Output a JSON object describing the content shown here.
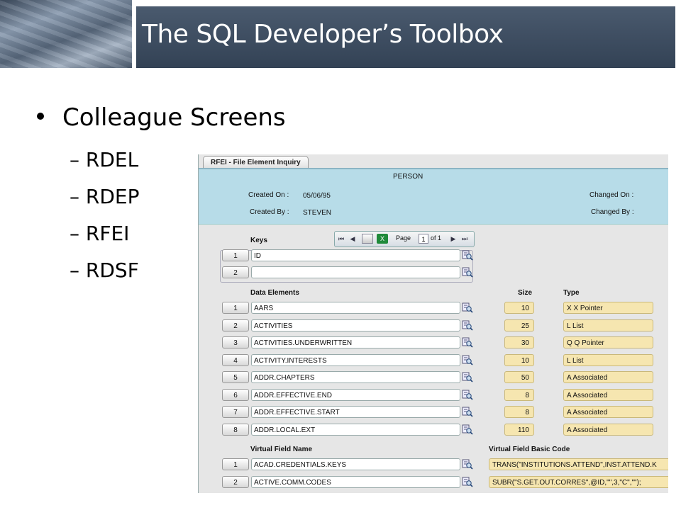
{
  "slide": {
    "title": "The SQL Developer’s Toolbox",
    "bullet": "Colleague Screens",
    "subitems": [
      "– RDEL",
      "– RDEP",
      "– RFEI",
      "– RDSF"
    ]
  },
  "app": {
    "tab_label": "RFEI - File Element Inquiry",
    "file_name": "PERSON",
    "created_on_label": "Created On :",
    "created_on_value": "05/06/95",
    "created_by_label": "Created By :",
    "created_by_value": "STEVEN",
    "changed_on_label": "Changed On :",
    "changed_by_label": "Changed By :",
    "pager": {
      "page_label": "Page",
      "page_value": "1",
      "of_label": "of 1"
    },
    "keys": {
      "header": "Keys",
      "rows": [
        {
          "num": "1",
          "value": "ID"
        },
        {
          "num": "2",
          "value": ""
        }
      ]
    },
    "data_elements": {
      "header": "Data Elements",
      "size_header": "Size",
      "type_header": "Type",
      "rows": [
        {
          "num": "1",
          "name": "AARS",
          "size": "10",
          "type": "X X Pointer"
        },
        {
          "num": "2",
          "name": "ACTIVITIES",
          "size": "25",
          "type": "L List"
        },
        {
          "num": "3",
          "name": "ACTIVITIES.UNDERWRITTEN",
          "size": "30",
          "type": "Q Q Pointer"
        },
        {
          "num": "4",
          "name": "ACTIVITY.INTERESTS",
          "size": "10",
          "type": "L List"
        },
        {
          "num": "5",
          "name": "ADDR.CHAPTERS",
          "size": "50",
          "type": "A Associated"
        },
        {
          "num": "6",
          "name": "ADDR.EFFECTIVE.END",
          "size": "8",
          "type": "A Associated"
        },
        {
          "num": "7",
          "name": "ADDR.EFFECTIVE.START",
          "size": "8",
          "type": "A Associated"
        },
        {
          "num": "8",
          "name": "ADDR.LOCAL.EXT",
          "size": "110",
          "type": "A Associated"
        }
      ]
    },
    "virtual_fields": {
      "header": "Virtual Field Name",
      "code_header": "Virtual Field Basic Code",
      "rows": [
        {
          "num": "1",
          "name": "ACAD.CREDENTIALS.KEYS",
          "code": "TRANS(\"INSTITUTIONS.ATTEND\",INST.ATTEND.K"
        },
        {
          "num": "2",
          "name": "ACTIVE.COMM.CODES",
          "code": "SUBR(\"S.GET.OUT.CORRES\",@ID,\"\",3,\"C\",\"\");"
        }
      ]
    }
  }
}
